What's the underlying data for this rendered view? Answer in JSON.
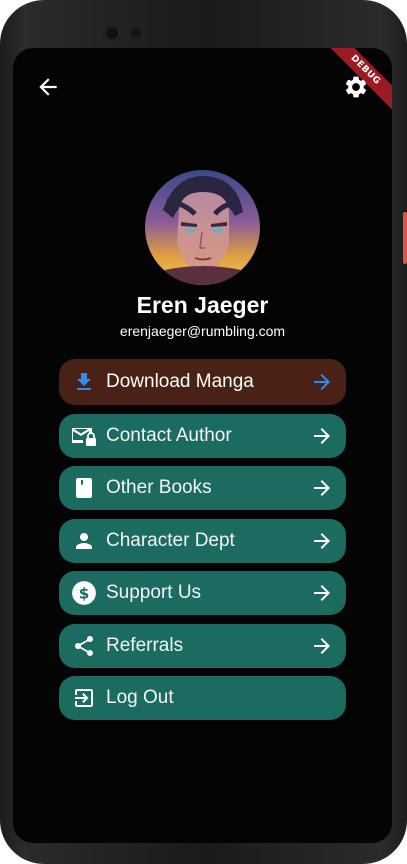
{
  "debug_banner": {
    "label": "DEBUG",
    "color": "#9c1b23"
  },
  "app_bar": {
    "back_icon": "arrow-left-icon",
    "settings_icon": "gear-icon"
  },
  "profile": {
    "name": "Eren Jaeger",
    "email": "erenjaeger@rumbling.com",
    "avatar": "profile-avatar-image"
  },
  "menu": {
    "items": [
      {
        "label": "Download Manga",
        "icon": "download-icon",
        "highlighted": true,
        "icon_color": "#2d8cf0",
        "arrow_color": "#2d8cf0"
      },
      {
        "label": "Contact Author",
        "icon": "mail-lock-icon",
        "highlighted": false
      },
      {
        "label": "Other Books",
        "icon": "book-icon",
        "highlighted": false
      },
      {
        "label": "Character Dept",
        "icon": "person-icon",
        "highlighted": false
      },
      {
        "label": "Support Us",
        "icon": "dollar-icon",
        "highlighted": false
      },
      {
        "label": "Referrals",
        "icon": "share-icon",
        "highlighted": false
      },
      {
        "label": "Log Out",
        "icon": "logout-icon",
        "highlighted": false
      }
    ]
  },
  "colors": {
    "background": "#040404",
    "menu_item": "#1b6b61",
    "menu_item_highlight": "#4a2116",
    "accent_blue": "#2d8cf0",
    "text": "#ffffff"
  }
}
